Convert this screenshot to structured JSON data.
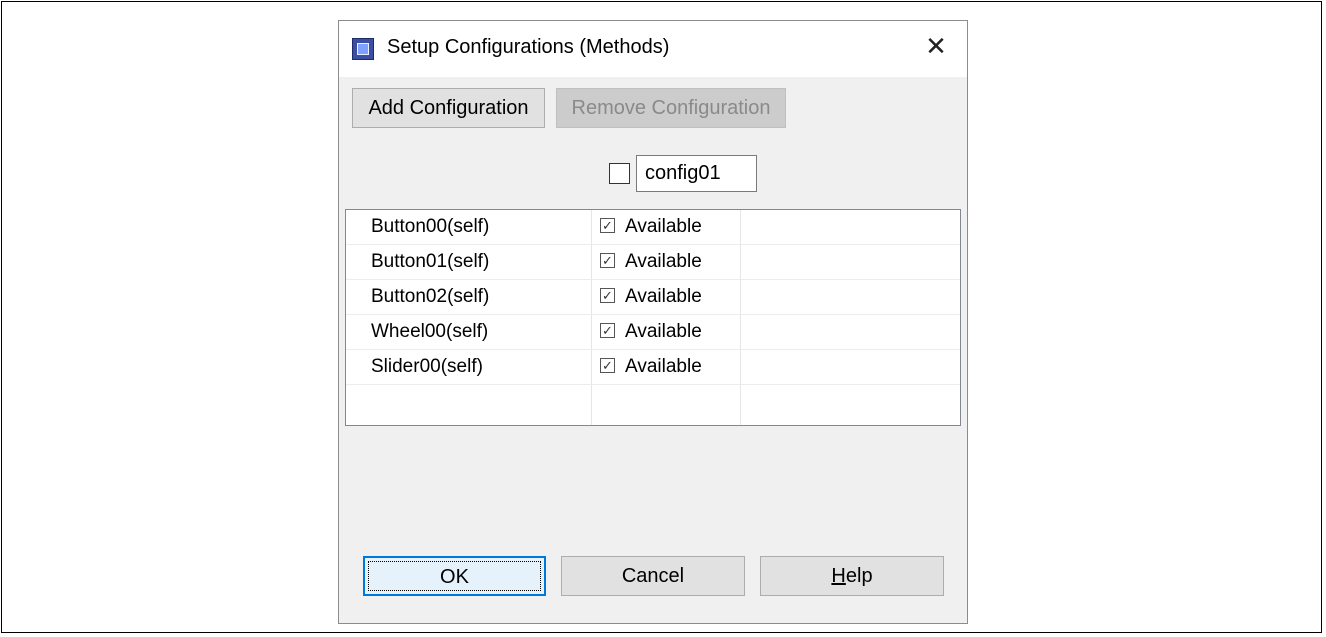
{
  "dialog": {
    "title": "Setup Configurations (Methods)",
    "close_icon": "close-icon"
  },
  "toolbar": {
    "add_label": "Add Configuration",
    "remove_label": "Remove Configuration",
    "remove_enabled": false
  },
  "config": {
    "checked": false,
    "name": "config01"
  },
  "methods": [
    {
      "name": "Button00(self)",
      "checked": true,
      "status": "Available"
    },
    {
      "name": "Button01(self)",
      "checked": true,
      "status": "Available"
    },
    {
      "name": "Button02(self)",
      "checked": true,
      "status": "Available"
    },
    {
      "name": "Wheel00(self)",
      "checked": true,
      "status": "Available"
    },
    {
      "name": "Slider00(self)",
      "checked": true,
      "status": "Available"
    }
  ],
  "footer": {
    "ok_label": "OK",
    "cancel_label": "Cancel",
    "help_mnemonic": "H",
    "help_rest": "elp"
  },
  "colors": {
    "accent": "#0078d7",
    "dialog_bg": "#f0f0f0"
  }
}
